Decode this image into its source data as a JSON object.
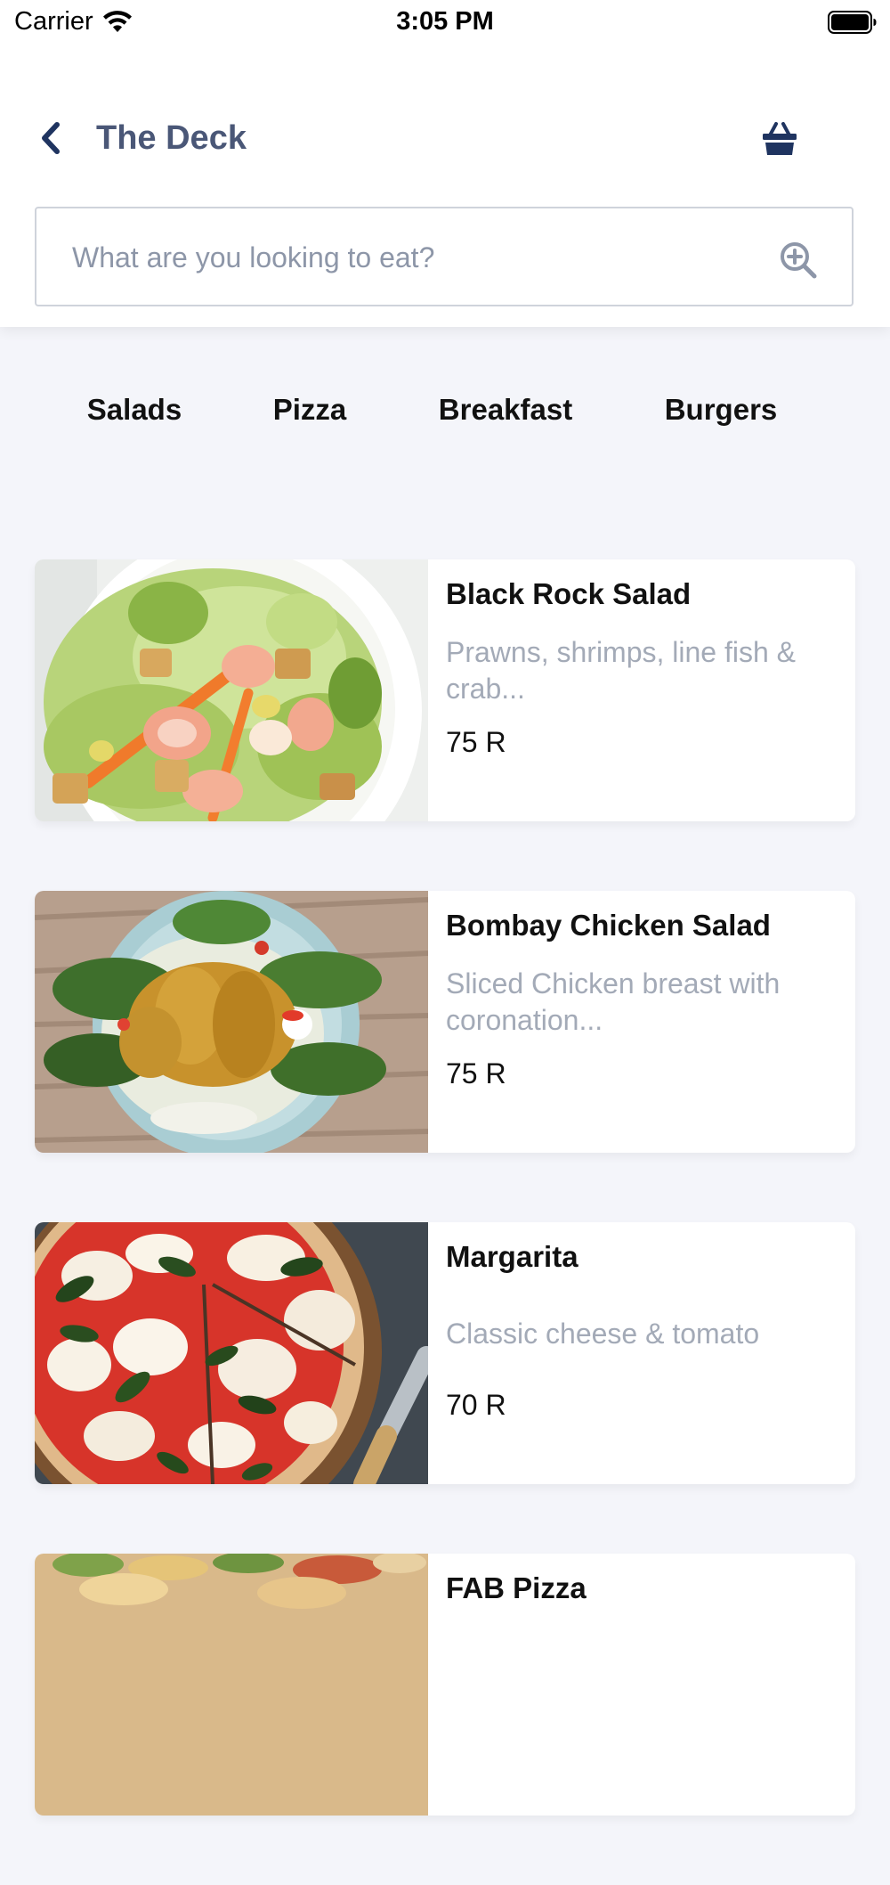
{
  "status_bar": {
    "carrier": "Carrier",
    "time": "3:05 PM"
  },
  "header": {
    "title": "The Deck",
    "back_icon": "chevron-left-icon",
    "cart_icon": "basket-icon"
  },
  "search": {
    "placeholder": "What are you looking to eat?",
    "value": "",
    "icon": "zoom-in-icon"
  },
  "categories": [
    "Salads",
    "Pizza",
    "Breakfast",
    "Burgers"
  ],
  "menu_items": [
    {
      "name": "Black Rock Salad",
      "description": "Prawns, shrimps, line fish & crab...",
      "price": "75 R"
    },
    {
      "name": "Bombay Chicken Salad",
      "description": "Sliced Chicken breast with coronation...",
      "price": "75 R"
    },
    {
      "name": "Margarita",
      "description": "Classic cheese & tomato",
      "price": "70 R"
    },
    {
      "name": "FAB Pizza",
      "description": "",
      "price": ""
    }
  ],
  "colors": {
    "accent": "#1f3460",
    "title": "#4a5777",
    "background": "#f4f5fa",
    "muted_text": "#a3aab7"
  }
}
